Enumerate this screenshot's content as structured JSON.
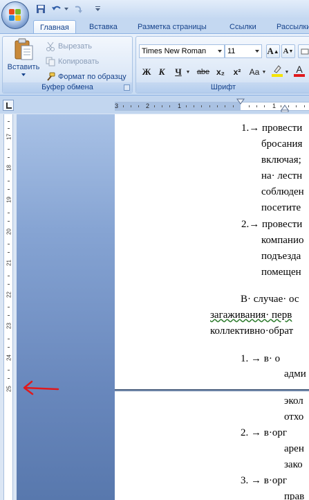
{
  "ribbon_tabs": [
    "Главная",
    "Вставка",
    "Разметка страницы",
    "Ссылки",
    "Рассылки"
  ],
  "clipboard": {
    "paste_label": "Вставить",
    "cut_label": "Вырезать",
    "copy_label": "Копировать",
    "format_painter_label": "Формат по образцу",
    "group_label": "Буфер обмена"
  },
  "font": {
    "name": "Times New Roman",
    "size": "11",
    "group_label": "Шрифт",
    "bold": "Ж",
    "italic": "К",
    "underline": "Ч",
    "strike": "abe",
    "subscript": "x₂",
    "superscript": "x²",
    "change_case": "Aa",
    "grow": "A",
    "shrink": "A"
  },
  "hruler_numbers": [
    "3",
    "2",
    "1",
    "1"
  ],
  "vruler_numbers": [
    "17",
    "18",
    "19",
    "20",
    "21",
    "22",
    "23",
    "24",
    "25"
  ],
  "document": {
    "page1_lines": [
      "1.→ провести",
      "бросания",
      "включая;",
      "на· лестн",
      "соблюден",
      "посетите",
      "2.→ провести",
      "компанио",
      "подъезда",
      "помещен",
      "В· случае· ос",
      "загаживания· перв",
      "коллективно·обрат",
      "1.    →    в· о",
      "адми"
    ],
    "page2_lines": [
      "экол",
      "отхо",
      "2.    →    в·орг",
      "арен",
      "зако",
      "3.    →    в·орг",
      "прав"
    ]
  },
  "colors": {
    "ribbon_text": "#15428b",
    "annotation_arrow": "#e0191c",
    "font_color_bar": "#e0191c",
    "highlight_bar": "#f5e300"
  }
}
